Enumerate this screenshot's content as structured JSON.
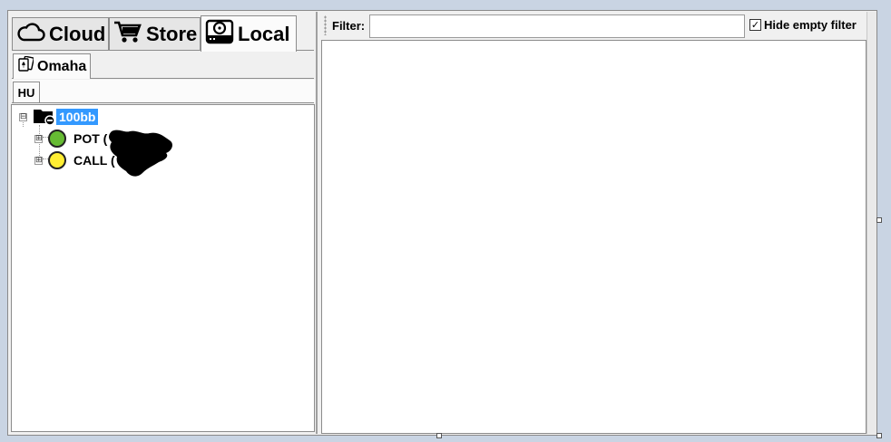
{
  "top_tabs": [
    {
      "label": "Cloud",
      "icon": "cloud-icon",
      "active": false
    },
    {
      "label": "Store",
      "icon": "cart-icon",
      "active": false
    },
    {
      "label": "Local",
      "icon": "hard-drive-icon",
      "active": true
    }
  ],
  "game_tab": {
    "label": "Omaha",
    "icon": "cards-icon"
  },
  "format_tab": {
    "label": "HU"
  },
  "tree": {
    "root": {
      "label": "100bb",
      "expander": "⊟",
      "icon": "folder-minus-icon"
    },
    "children": [
      {
        "label": "POT (",
        "expander": "⊞",
        "color": "#66bb33"
      },
      {
        "label": "CALL (",
        "expander": "⊞",
        "color": "#ffee33"
      }
    ]
  },
  "filter": {
    "label": "Filter:",
    "value": "",
    "placeholder": ""
  },
  "hide_empty_filter": {
    "label": "Hide empty filter",
    "checked": true
  }
}
